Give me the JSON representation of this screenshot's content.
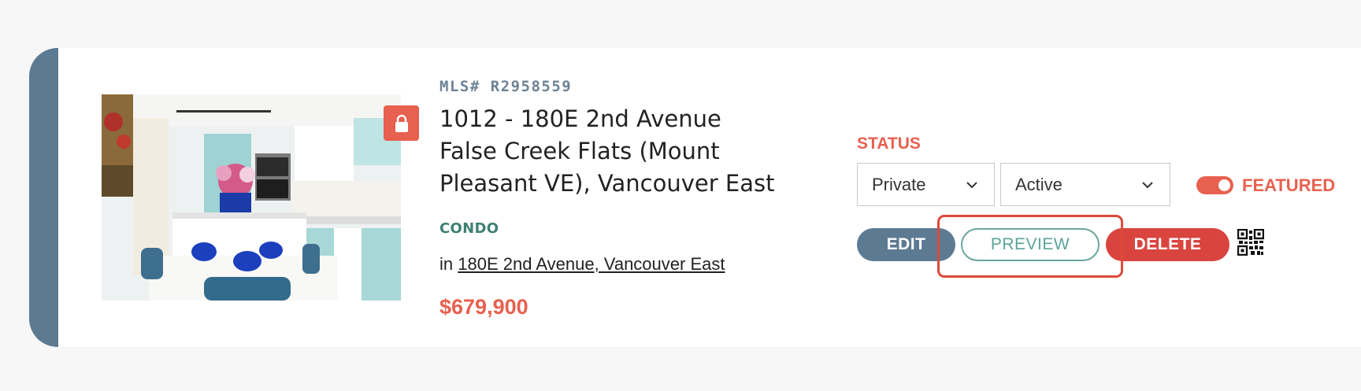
{
  "listing": {
    "mls": "MLS# R2958559",
    "address_line1": "1012 - 180E 2nd Avenue",
    "address_line2": "False Creek Flats (Mount",
    "address_line3": "Pleasant VE), Vancouver East",
    "property_type": "CONDO",
    "location_prefix": "in",
    "location_link": "180E 2nd Avenue, Vancouver East",
    "price": "$679,900",
    "photo_icon": "lock-icon"
  },
  "status": {
    "label": "STATUS",
    "visibility_value": "Private",
    "state_value": "Active",
    "featured_label": "FEATURED",
    "featured_on": true
  },
  "actions": {
    "edit": "EDIT",
    "preview": "PREVIEW",
    "delete": "DELETE",
    "qr_icon": "qr-code-icon"
  },
  "colors": {
    "accent": "#5d7a93",
    "brand_red": "#e8604f",
    "delete_red": "#d9443f",
    "preview_teal": "#5aa398",
    "type_green": "#3e7f73"
  }
}
